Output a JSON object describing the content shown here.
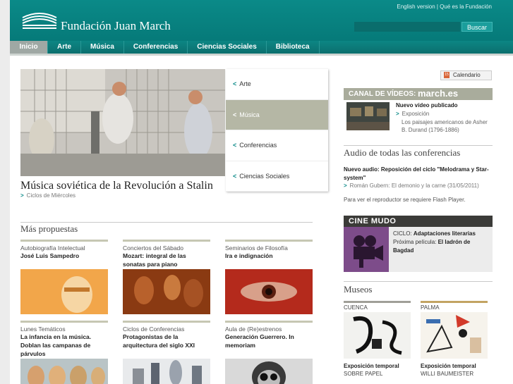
{
  "brand": {
    "name": "Fundación Juan March"
  },
  "toplinks": {
    "english": "English version",
    "sep": " | ",
    "about": "Qué es la Fundación"
  },
  "search": {
    "placeholder": "",
    "button": "Buscar"
  },
  "nav": [
    "Inicio",
    "Arte",
    "Música",
    "Conferencias",
    "Ciencias Sociales",
    "Biblioteca"
  ],
  "hero": {
    "title": "Música soviética de la Revolución a Stalin",
    "subtitle": "Ciclos de Miércoles",
    "tabs": [
      "Arte",
      "Música",
      "Conferencias",
      "Ciencias Sociales"
    ],
    "active_tab": "Música"
  },
  "more": {
    "title": "Más propuestas",
    "cards": [
      {
        "category": "Autobiografía Intelectual",
        "title": "José Luis Sampedro"
      },
      {
        "category": "Conciertos del Sábado",
        "title": "Mozart: integral de las sonatas para piano"
      },
      {
        "category": "Seminarios de Filosofía",
        "title": "Ira e indignación"
      },
      {
        "category": "Lunes Temáticos",
        "title": "La infancia en la música. Doblan las campanas de párvulos"
      },
      {
        "category": "Ciclos de Conferencias",
        "title": "Protagonistas de la arquitectura del siglo XXI"
      },
      {
        "category": "Aula de (Re)estrenos",
        "title": "Generación Guerrero. In memoriam"
      }
    ]
  },
  "calendar": {
    "label": "Calendario",
    "icon_text": "15"
  },
  "videos": {
    "title": "CANAL DE VÍDEOS:",
    "site": "march.es",
    "new_label": "Nuevo vídeo publicado",
    "line1": "Exposición",
    "line2": "Los paisajes americanos de Asher",
    "line3": "B. Durand (1796-1886)"
  },
  "audio": {
    "title": "Audio de todas las conferencias",
    "new_label": "Nuevo audio: Reposición del ciclo \"Melodrama y Star-system\"",
    "item": "Román Gubern: El demonio y la carne (31/05/2011)",
    "note": "Para ver el reproductor se requiere Flash Player."
  },
  "cine": {
    "title": "CINE MUDO",
    "ciclo_label": "CICLO:",
    "ciclo": "Adaptaciones literarias",
    "next_label": "Próxima película:",
    "next": "El ladrón de Bagdad"
  },
  "museos": {
    "title": "Museos",
    "items": [
      {
        "city": "CUENCA",
        "t1": "Exposición temporal",
        "t2": "SOBRE PAPEL"
      },
      {
        "city": "PALMA",
        "t1": "Exposición temporal",
        "t2": "WILLI BAUMEISTER"
      }
    ]
  },
  "colors": {
    "brand": "#0a8a88",
    "nav_active": "#9fa8a4",
    "tab_active": "#b5b7a5"
  }
}
